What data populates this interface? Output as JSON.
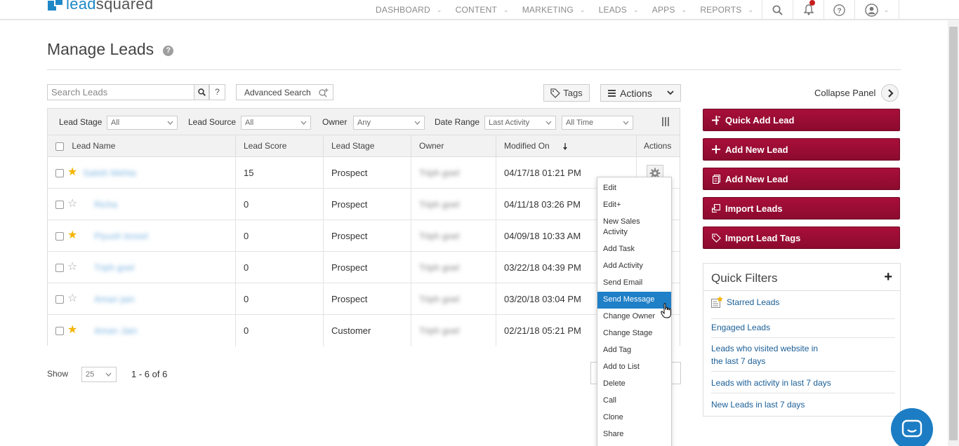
{
  "nav": {
    "logo_text_a": "lead",
    "logo_text_b": "squared",
    "items": [
      "DASHBOARD",
      "CONTENT",
      "MARKETING",
      "LEADS",
      "APPS",
      "REPORTS"
    ]
  },
  "page": {
    "title": "Manage Leads",
    "help": "?"
  },
  "toolbar": {
    "search_placeholder": "Search Leads",
    "help_label": "?",
    "advanced_search": "Advanced Search",
    "tags": "Tags",
    "actions": "Actions"
  },
  "filters": {
    "lead_stage_label": "Lead Stage",
    "lead_stage_value": "All",
    "lead_source_label": "Lead Source",
    "lead_source_value": "All",
    "owner_label": "Owner",
    "owner_value": "Any",
    "date_range_label": "Date Range",
    "date_range_value": "Last Activity",
    "time_value": "All Time"
  },
  "table": {
    "headers": {
      "lead_name": "Lead Name",
      "lead_score": "Lead Score",
      "lead_stage": "Lead Stage",
      "owner": "Owner",
      "modified_on": "Modified On",
      "actions": "Actions"
    },
    "rows": [
      {
        "starred": true,
        "name": "Satish Mehta",
        "score": "15",
        "stage": "Prospect",
        "owner": "Triph goel",
        "modified": "04/17/18 01:21 PM"
      },
      {
        "starred": false,
        "name": "Richa",
        "score": "0",
        "stage": "Prospect",
        "owner": "Triph goel",
        "modified": "04/11/18 03:26 PM"
      },
      {
        "starred": true,
        "name": "Piyush tessel",
        "score": "0",
        "stage": "Prospect",
        "owner": "Triph goel",
        "modified": "04/09/18 10:33 AM"
      },
      {
        "starred": false,
        "name": "Triph goel",
        "score": "0",
        "stage": "Prospect",
        "owner": "Triph goel",
        "modified": "03/22/18 04:39 PM"
      },
      {
        "starred": false,
        "name": "Aman jain",
        "score": "0",
        "stage": "Prospect",
        "owner": "Triph goel",
        "modified": "03/20/18 03:04 PM"
      },
      {
        "starred": true,
        "name": "Aman Jain",
        "score": "0",
        "stage": "Customer",
        "owner": "Triph goel",
        "modified": "02/21/18 05:21 PM"
      }
    ]
  },
  "pagination": {
    "show_label": "Show",
    "page_size": "25",
    "count_text": "1 - 6 of 6"
  },
  "action_menu": {
    "items": [
      "Edit",
      "Edit+",
      "New Sales Activity",
      "Add Task",
      "Add Activity",
      "Send Email",
      "Send Message",
      "Change Owner",
      "Change Stage",
      "Add Tag",
      "Add to List",
      "Delete",
      "Call",
      "Clone",
      "Share"
    ],
    "active_index": 6
  },
  "right_panel": {
    "collapse_label": "Collapse Panel",
    "buttons": [
      "Quick Add Lead",
      "Add New Lead",
      "Add New Lead",
      "Import Leads",
      "Import Lead Tags"
    ],
    "quick_filters": {
      "title": "Quick Filters",
      "items": [
        "Starred Leads",
        "Engaged Leads",
        "Leads who visited website in the last 7 days",
        "Leads with activity in last 7 days",
        "New Leads in last 7 days"
      ]
    }
  },
  "colors": {
    "brand_button": "#8c0a2e",
    "link": "#1a5e96",
    "menu_active": "#1f7fc7",
    "star": "#f5b400"
  }
}
